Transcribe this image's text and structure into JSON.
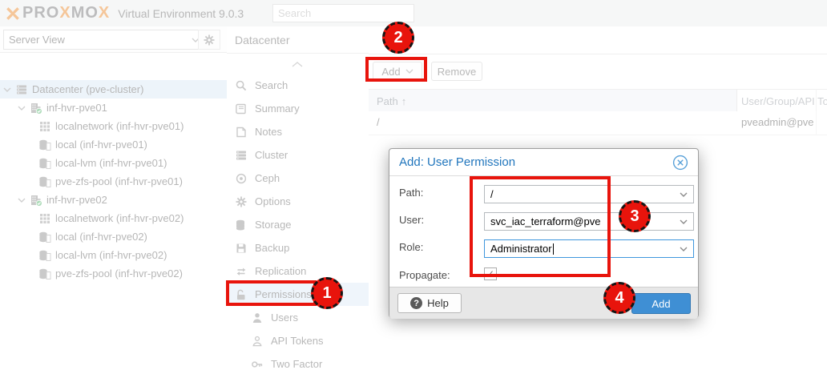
{
  "colors": {
    "annotation_red": "#e8140c",
    "dialog_title_blue": "#2176bd",
    "primary_button_blue": "#3f8fd4",
    "logo_orange": "#e57000",
    "node_check_green": "#35a854",
    "selection_blue": "#d2e3f2"
  },
  "topbar": {
    "logo_seg1": "PRO",
    "logo_x1": "X",
    "logo_seg2": "MO",
    "logo_x2": "X",
    "subtitle": "Virtual Environment 9.0.3",
    "search_placeholder": "Search"
  },
  "sidebar": {
    "view_selector": "Server View",
    "tree": [
      "Datacenter (pve-cluster)",
      "inf-hvr-pve01",
      "localnetwork (inf-hvr-pve01)",
      "local (inf-hvr-pve01)",
      "local-lvm (inf-hvr-pve01)",
      "pve-zfs-pool (inf-hvr-pve01)",
      "inf-hvr-pve02",
      "localnetwork (inf-hvr-pve02)",
      "local (inf-hvr-pve02)",
      "local-lvm (inf-hvr-pve02)",
      "pve-zfs-pool (inf-hvr-pve02)"
    ]
  },
  "nav": {
    "title": "Datacenter",
    "items": [
      "Search",
      "Summary",
      "Notes",
      "Cluster",
      "Ceph",
      "Options",
      "Storage",
      "Backup",
      "Replication",
      "Permissions",
      "Users",
      "API Tokens",
      "Two Factor"
    ]
  },
  "content": {
    "toolbar": {
      "add": "Add",
      "remove": "Remove"
    },
    "table": {
      "path_header": "Path",
      "sort_arrow": "↑",
      "user_header": "User/Group/API To",
      "row": {
        "path": "/",
        "user": "pveadmin@pve"
      }
    }
  },
  "dialog": {
    "title": "Add: User Permission",
    "path_label": "Path:",
    "path_value": "/",
    "user_label": "User:",
    "user_value": "svc_iac_terraform@pve",
    "role_label": "Role:",
    "role_value": "Administrator",
    "propagate_label": "Propagate:",
    "checkbox_check": "✓",
    "help": "Help",
    "help_icon": "?",
    "add": "Add"
  },
  "annotations": [
    "1",
    "2",
    "3",
    "4"
  ]
}
